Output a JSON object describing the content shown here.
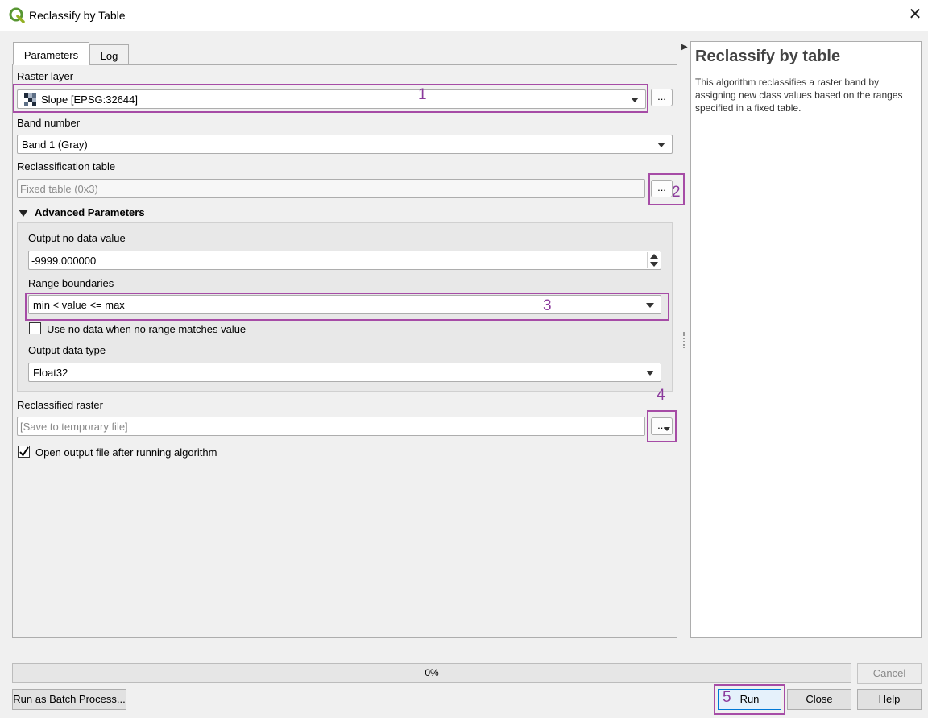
{
  "window": {
    "title": "Reclassify by Table",
    "close_glyph": "✕"
  },
  "tabs": [
    {
      "label": "Parameters"
    },
    {
      "label": "Log"
    }
  ],
  "params": {
    "raster_layer": {
      "label": "Raster layer",
      "value": "Slope [EPSG:32644]"
    },
    "band_number": {
      "label": "Band number",
      "value": "Band 1 (Gray)"
    },
    "reclass_table": {
      "label": "Reclassification table",
      "value": "Fixed table (0x3)"
    },
    "advanced": {
      "header": "Advanced Parameters",
      "no_data": {
        "label": "Output no data value",
        "value": "-9999.000000"
      },
      "range_boundaries": {
        "label": "Range boundaries",
        "value": "min < value <= max"
      },
      "use_no_data": {
        "label": "Use no data when no range matches value",
        "checked": false
      },
      "output_type": {
        "label": "Output data type",
        "value": "Float32"
      }
    },
    "reclassified_raster": {
      "label": "Reclassified raster",
      "placeholder": "[Save to temporary file]"
    },
    "open_output": {
      "label": "Open output file after running algorithm",
      "checked": true
    },
    "browse_label": "..."
  },
  "annotations": [
    "1",
    "2",
    "3",
    "4",
    "5"
  ],
  "help": {
    "title": "Reclassify by table",
    "text": "This algorithm reclassifies a raster band by assigning new class values based on the ranges specified in a fixed table."
  },
  "progress": {
    "label": "0%",
    "fraction": 0
  },
  "buttons": {
    "cancel": "Cancel",
    "batch": "Run as Batch Process...",
    "run": "Run",
    "close": "Close",
    "help": "Help"
  },
  "colors": {
    "annotation": "#a64ca6",
    "accent": "#0078d7"
  }
}
